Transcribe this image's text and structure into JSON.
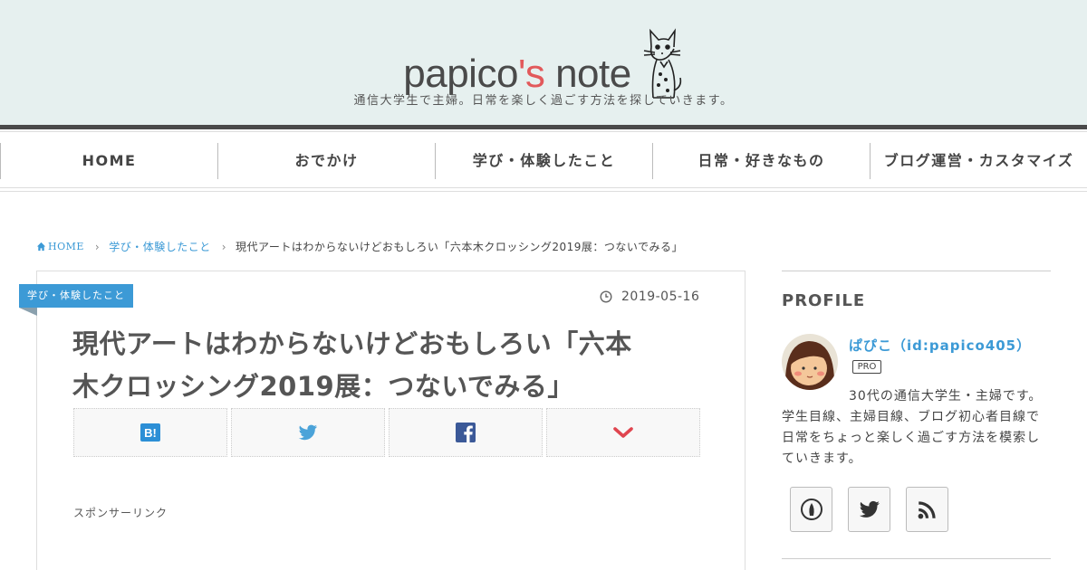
{
  "header": {
    "logo_main": "papico",
    "logo_apos": "'s",
    "logo_rest": " note",
    "tagline": "通信大学生で主婦。日常を楽しく過ごす方法を探していきます。"
  },
  "nav": {
    "items": [
      {
        "label": "HOME"
      },
      {
        "label": "おでかけ"
      },
      {
        "label": "学び・体験したこと"
      },
      {
        "label": "日常・好きなもの"
      },
      {
        "label": "ブログ運営・カスタマイズ"
      }
    ]
  },
  "breadcrumb": {
    "home": "HOME",
    "category": "学び・体験したこと",
    "current": "現代アートはわからないけどおもしろい「六本木クロッシング2019展：つないでみる」"
  },
  "article": {
    "category": "学び・体験したこと",
    "date": "2019-05-16",
    "title_line1": "現代アートはわからないけどおもしろい「六本",
    "title_line2": "木クロッシング2019展：つないでみる」",
    "share_buttons": [
      "hatena-bookmark",
      "twitter",
      "facebook",
      "pocket"
    ],
    "sponsor": "スポンサーリンク"
  },
  "sidebar": {
    "heading": "PROFILE",
    "name": "ぱぴこ（id:papico405）",
    "badge": "PRO",
    "description": "30代の通信大学生・主婦です。学生目線、主婦目線、ブログ初心者目線で日常をちょっと楽しく過ごす方法を模索していきます。",
    "social": [
      "hatena-icon",
      "twitter-icon",
      "rss-icon"
    ]
  },
  "colors": {
    "accent": "#3c9ad6",
    "logo_accent": "#e2595b",
    "header_bg": "#e6f0ef",
    "pocket": "#e0454f"
  }
}
